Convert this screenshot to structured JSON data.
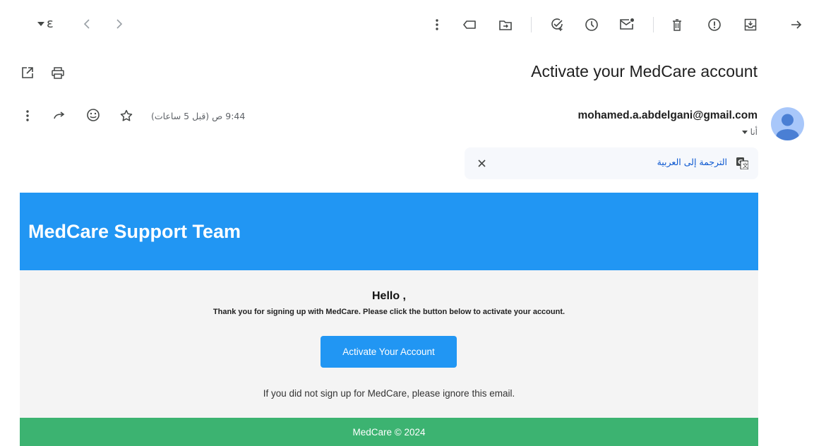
{
  "toolbar": {
    "page_indicator": "ε",
    "icons": [
      "caret-down-icon",
      "chevron-left-icon",
      "chevron-right-icon",
      "more-vert-icon",
      "label-icon",
      "move-to-icon",
      "add-task-icon",
      "snooze-icon",
      "mark-unread-icon",
      "delete-icon",
      "report-spam-icon",
      "archive-icon",
      "back-arrow-icon"
    ]
  },
  "message": {
    "subject": "Activate your MedCare account",
    "sender_email": "mohamed.a.abdelgani@gmail.com",
    "recipient_label": "أنا",
    "time": "9:44 ص (قبل 5 ساعات)"
  },
  "translate_bar": {
    "label": "الترجمة إلى العربية"
  },
  "email_content": {
    "header_title": "MedCare Support Team",
    "greeting": "Hello ,",
    "intro": "Thank you for signing up with MedCare. Please click the button below to activate your account.",
    "button_label": "Activate Your Account",
    "ignore_note": "If you did not sign up for MedCare, please ignore this email.",
    "footer": "MedCare © 2024"
  },
  "colors": {
    "header_blue": "#2196f3",
    "footer_green": "#3cb371",
    "body_gray": "#f4f4f4",
    "avatar_blue": "#a8c7fa",
    "link_blue": "#0b57d0"
  }
}
